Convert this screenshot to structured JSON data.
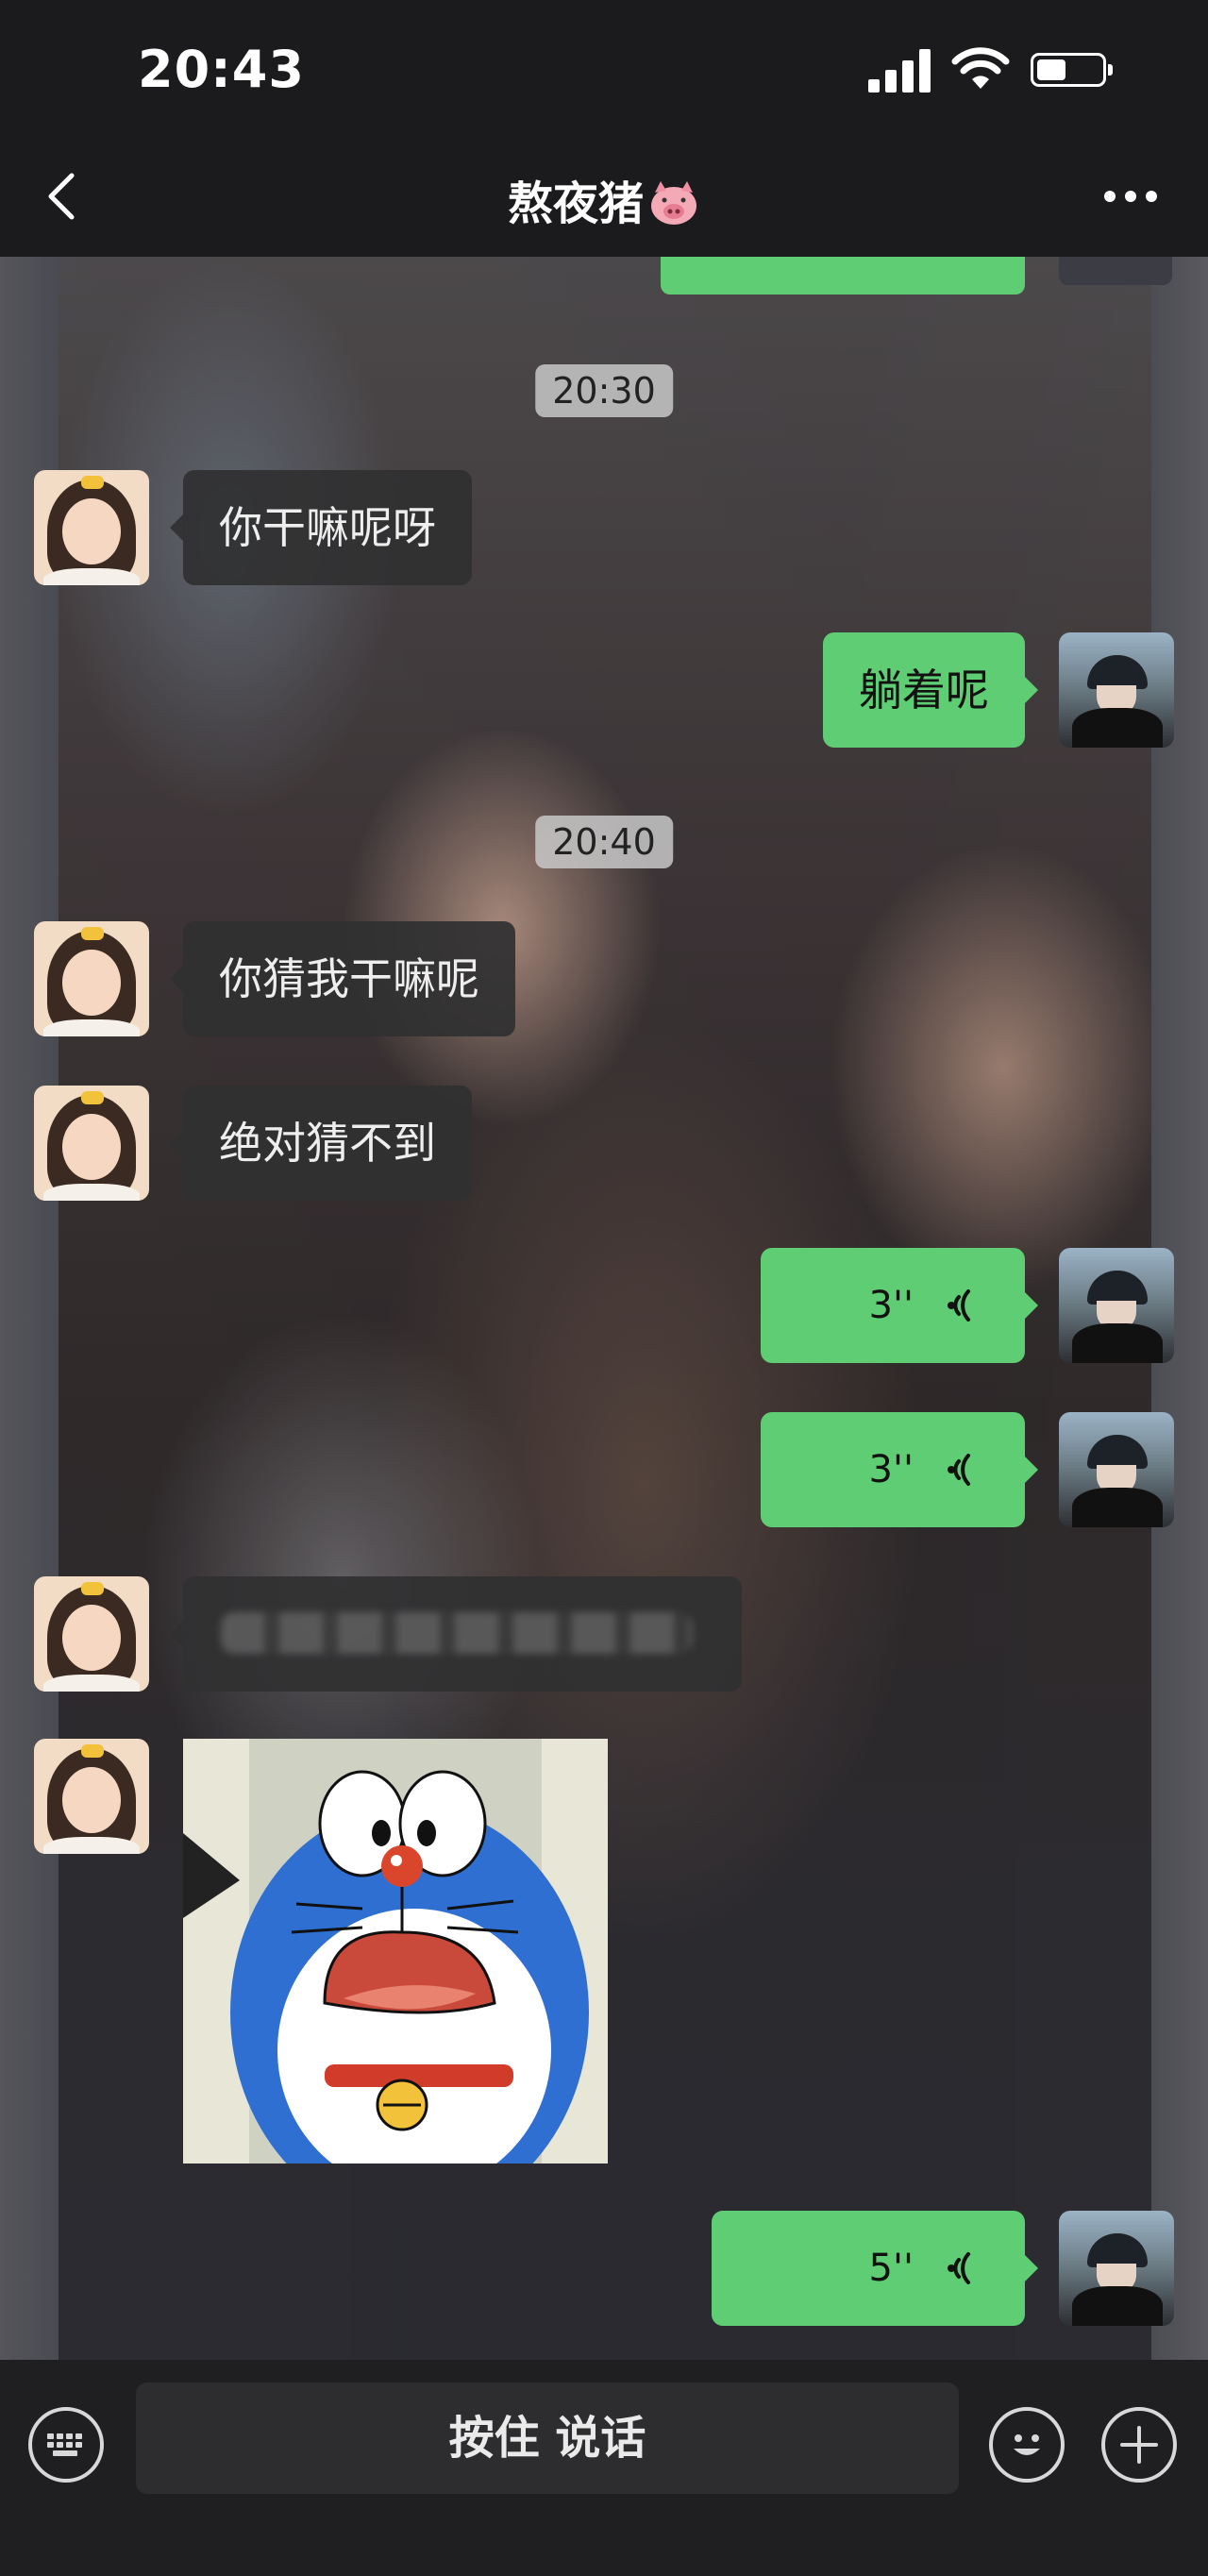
{
  "status_bar": {
    "time": "20:43",
    "signal_icon": "cellular-signal-icon",
    "wifi_icon": "wifi-icon",
    "battery_icon": "battery-icon",
    "battery_level": 0.35
  },
  "nav": {
    "back_icon": "chevron-left-icon",
    "title": "熬夜猪",
    "title_emoji_icon": "pig-face-icon",
    "more_icon": "more-dots-icon"
  },
  "chat": {
    "timestamps": [
      "20:30",
      "20:40"
    ],
    "messages": [
      {
        "side": "left",
        "type": "text",
        "text": "你干嘛呢呀"
      },
      {
        "side": "right",
        "type": "text",
        "text": "躺着呢"
      },
      {
        "side": "left",
        "type": "text",
        "text": "你猜我干嘛呢"
      },
      {
        "side": "left",
        "type": "text",
        "text": "绝对猜不到"
      },
      {
        "side": "right",
        "type": "voice",
        "duration": "3''"
      },
      {
        "side": "right",
        "type": "voice",
        "duration": "3''"
      },
      {
        "side": "left",
        "type": "text-blurred"
      },
      {
        "side": "left",
        "type": "sticker",
        "sticker_icon": "doraemon-sticker"
      },
      {
        "side": "right",
        "type": "voice",
        "duration": "5''"
      }
    ]
  },
  "input_bar": {
    "keyboard_icon": "keyboard-icon",
    "hold_to_talk": "按住 说话",
    "emoji_icon": "smiley-icon",
    "plus_icon": "plus-icon"
  },
  "colors": {
    "outgoing_bubble": "#5fcd73",
    "incoming_bubble": "#303032",
    "bar_background": "#1b1b1d"
  }
}
